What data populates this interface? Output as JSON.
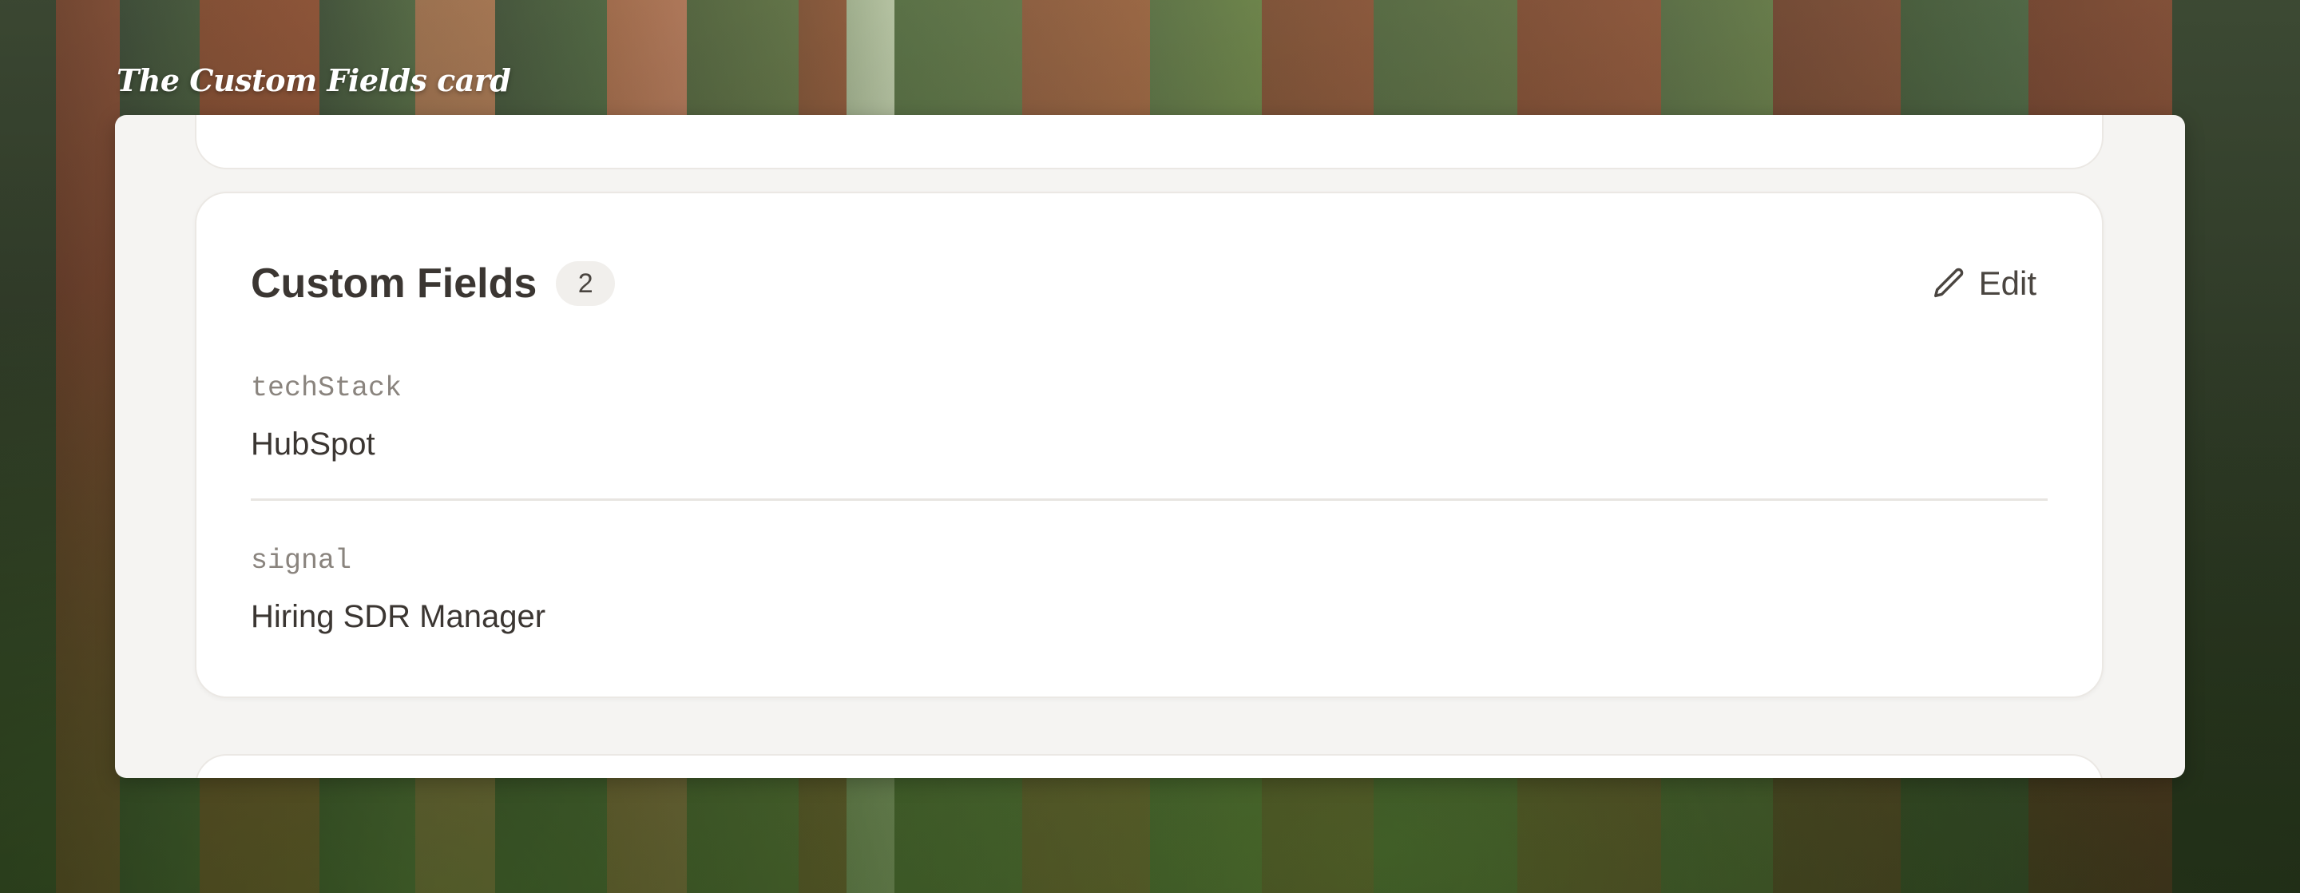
{
  "caption": "The Custom Fields card",
  "card": {
    "title": "Custom Fields",
    "count": "2",
    "edit_label": "Edit",
    "edit_icon": "pencil-icon",
    "fields": [
      {
        "key": "techStack",
        "value": "HubSpot"
      },
      {
        "key": "signal",
        "value": "Hiring SDR Manager"
      }
    ]
  },
  "colors": {
    "panel_background": "#f5f4f2",
    "card_background": "#ffffff",
    "title_text": "#3b3632",
    "key_text": "#8a847e",
    "badge_background": "#f1efec"
  }
}
